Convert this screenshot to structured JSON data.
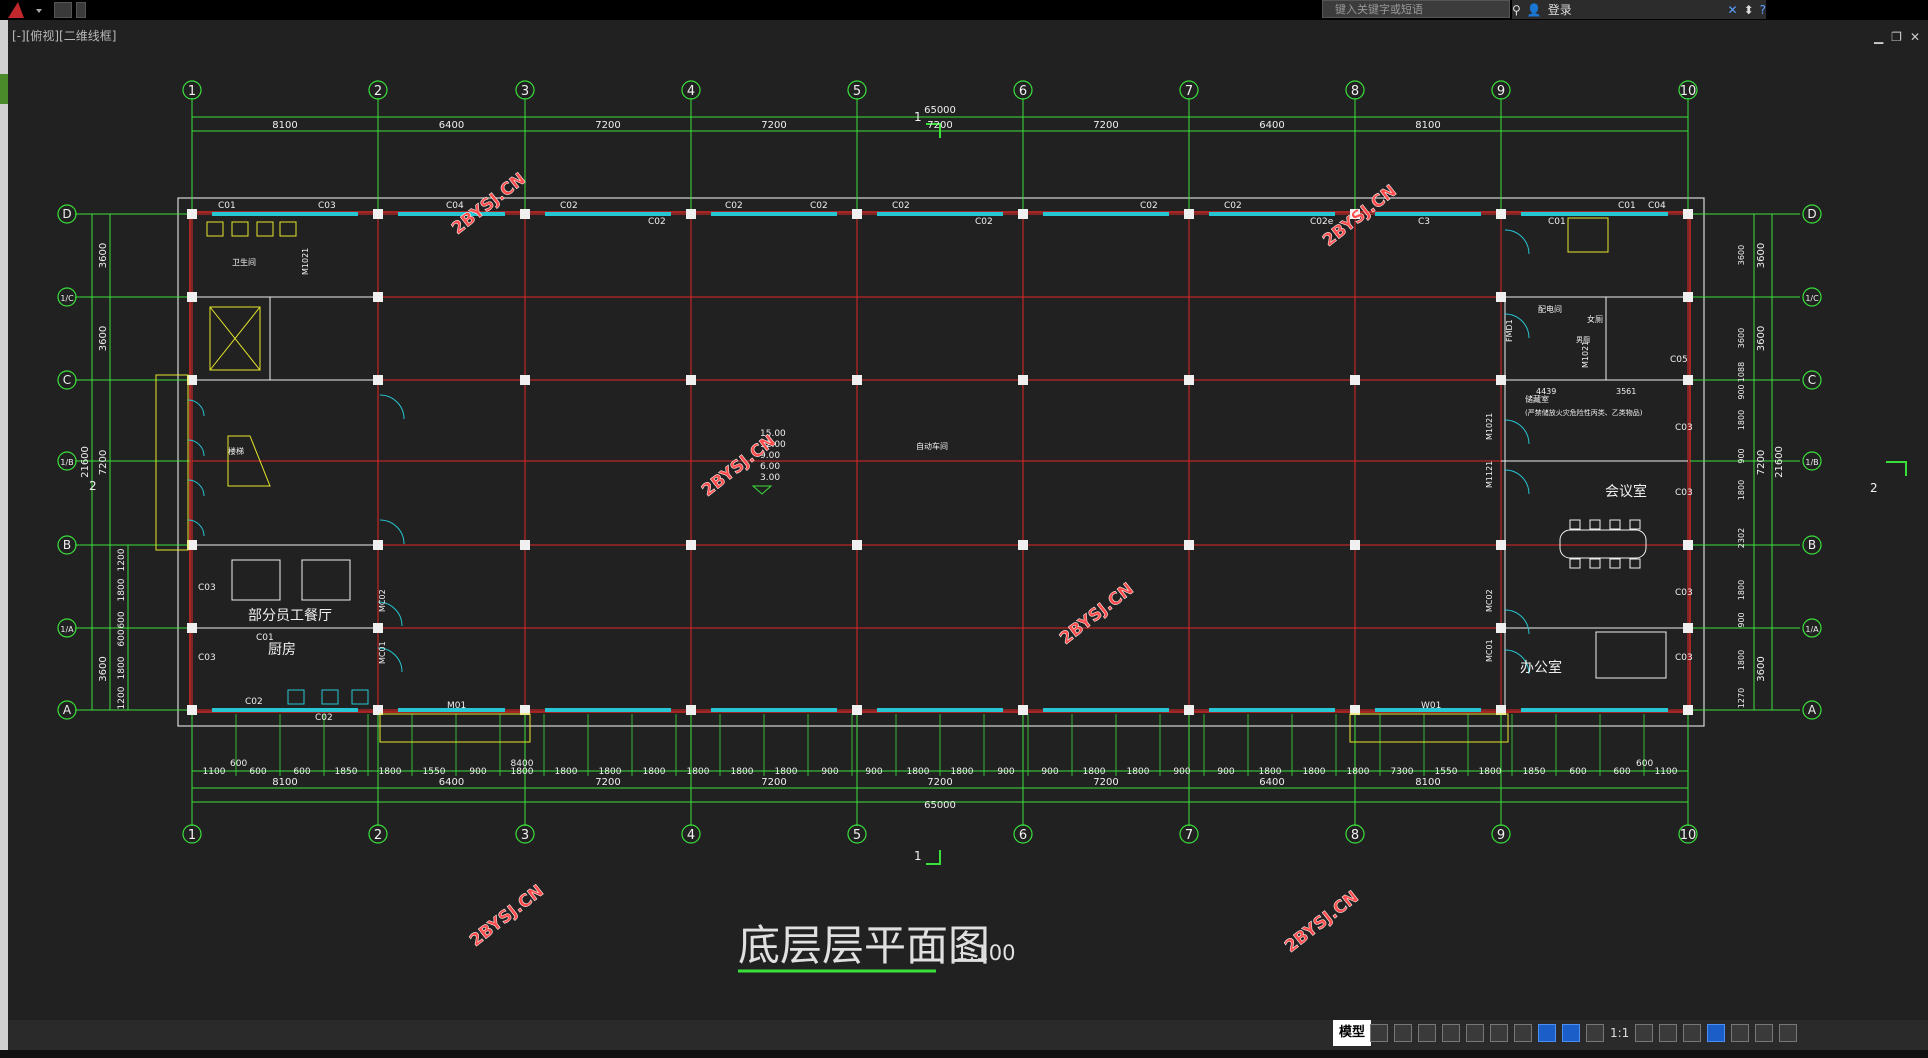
{
  "app": {
    "search_placeholder": "键入关键字或短语",
    "login": "登录",
    "viewport_label": "[-][俯视][二维线框]"
  },
  "drawing": {
    "title": "底层层平面图",
    "scale": "1:100",
    "watermark": "2BYSJ.CN",
    "axes_top": [
      "1",
      "2",
      "3",
      "4",
      "5",
      "6",
      "7",
      "8",
      "9",
      "10"
    ],
    "axes_side": [
      "D",
      "1/C",
      "C",
      "1/B",
      "B",
      "1/A",
      "A"
    ],
    "dims_top": [
      "8100",
      "6400",
      "7200",
      "7200",
      "7200",
      "7200",
      "6400",
      "8100"
    ],
    "total": "65000",
    "dims_left": [
      "3600",
      "3600",
      "7200",
      "3600"
    ],
    "dims_left_detail": [
      "1200",
      "1800",
      "600",
      "600",
      "1800",
      "1200"
    ],
    "left_total": "21600",
    "dims_right": [
      "3600",
      "3600",
      "7200",
      "3600"
    ],
    "right_total": "21600",
    "bottom_detail": [
      "1100",
      "600",
      "600",
      "1850",
      "1800",
      "1550",
      "900",
      "1800",
      "1800",
      "1800",
      "1800",
      "1800",
      "1800",
      "1800",
      "900",
      "900",
      "1800",
      "1800",
      "900",
      "900",
      "1800",
      "1800",
      "900",
      "900",
      "1800",
      "1800",
      "1800",
      "7300",
      "1550",
      "1800",
      "1850",
      "600",
      "600",
      "1100"
    ],
    "dim_8400": "8400",
    "dim_600": "600",
    "rooms": {
      "meeting": "会议室",
      "office": "办公室",
      "dining": "部分员工餐厅",
      "kitchen": "厨房",
      "workshop": "自动车间",
      "wc": "卫生间",
      "toilet": "女厕",
      "stair": "楼梯",
      "room_c": "配电间",
      "note_c": "储藏室",
      "note_c2": "(严禁储放火灾危险性丙类、乙类物品)",
      "men": "男厕"
    },
    "elevations": [
      "15.00",
      "12.00",
      "9.00",
      "6.00",
      "3.00"
    ],
    "section_marks": [
      "1",
      "2"
    ],
    "labels_window": [
      "C01",
      "C03",
      "C04",
      "C02",
      "C02",
      "C02",
      "C02",
      "C02",
      "C02",
      "C02",
      "C02",
      "C02e",
      "C01",
      "C01",
      "C04",
      "C3",
      "C01",
      "C02",
      "C02",
      "M01",
      "W01",
      "C05",
      "C03",
      "C03",
      "C03",
      "C03",
      "C03",
      "C03"
    ],
    "labels_door": [
      "M1021",
      "FMD1",
      "M1021",
      "M1021",
      "M1121",
      "MC02",
      "MC01",
      "MC02",
      "MC01"
    ],
    "right_dims": [
      "3600",
      "3600",
      "1088",
      "900",
      "1800",
      "900",
      "1800",
      "2302",
      "1800",
      "900",
      "1800",
      "1270"
    ],
    "room_dims": [
      "4439",
      "3561"
    ]
  },
  "status": {
    "model": "模型",
    "scale": "1:1"
  }
}
